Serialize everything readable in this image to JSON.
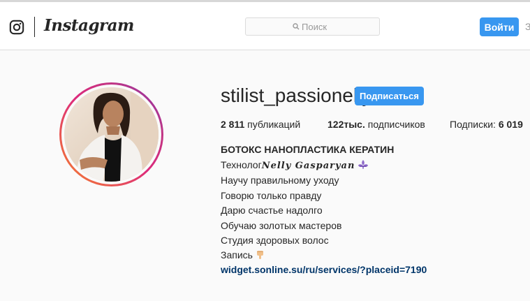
{
  "header": {
    "brand_name": "Instagram",
    "search_placeholder": "Поиск",
    "login_label": "Войти",
    "edge_link": "З"
  },
  "profile": {
    "username": "stilist_passionelly",
    "follow_label": "Подписаться",
    "stats": {
      "posts_value": "2 811",
      "posts_label": "публикаций",
      "followers_value": "122тыс.",
      "followers_label": "подписчиков",
      "following_label": "Подписки:",
      "following_value": "6 019"
    },
    "bio": {
      "title": "БОТОКС НАНОПЛАСТИКА КЕРАТИН",
      "line1_prefix": "Технолог",
      "line1_name": "𝑵𝒆𝒍𝒍𝒚 𝑮𝒂𝒔𝒑𝒂𝒓𝒚𝒂𝒏",
      "line2": "Научу правильному уходу",
      "line3": "Говорю только правду",
      "line4": "Дарю счастье надолго",
      "line5": "Обучаю золотых мастеров",
      "line6": "Студия здоровых волос",
      "line7": "Запись",
      "link": "widget.sonline.su/ru/services/?placeid=7190"
    }
  },
  "icons": {
    "brand": "instagram-glyph-icon",
    "search": "search-icon",
    "fleur": "fleur-de-lis-icon",
    "hand": "pointing-down-hand-icon"
  },
  "colors": {
    "accent": "#3897f0",
    "link": "#003569",
    "ring_start": "#f58529",
    "ring_end": "#8134af"
  }
}
